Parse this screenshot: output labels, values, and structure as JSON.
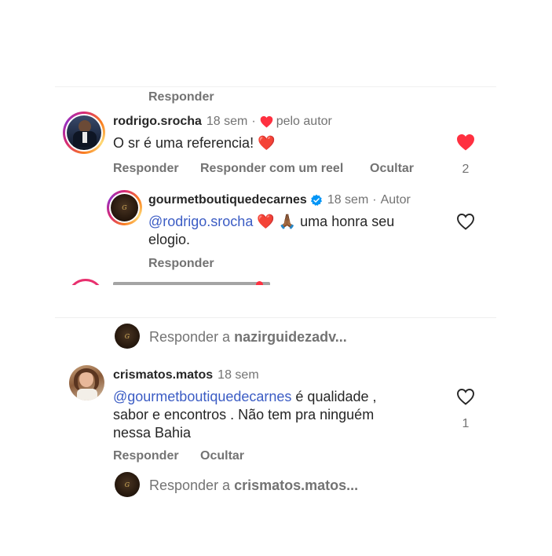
{
  "comments": [
    {
      "username": "rodrigo.srocha",
      "time": "18 sem",
      "author_like_label": "pelo autor",
      "text": "O sr é uma referencia! ❤️",
      "actions": [
        "Responder",
        "Responder com um reel",
        "Ocultar"
      ],
      "likes": "2",
      "liked": true,
      "reply": {
        "username": "gourmetboutiquedecarnes",
        "time": "18 sem",
        "author_badge": "Autor",
        "mention": "@rodrigo.srocha",
        "text_line1_after_mention": " ❤️ 🙏🏾 uma honra seu",
        "text_line2": "elogio.",
        "action": "Responder"
      }
    },
    {
      "username": "crismatos.matos",
      "time": "18 sem",
      "mention": "@gourmetboutiquedecarnes",
      "text_line1_after_mention": " é qualidade ,",
      "text_line2": "sabor e encontros . Não tem pra ninguém",
      "text_line3": "nessa Bahia",
      "actions": [
        "Responder",
        "Ocultar"
      ],
      "likes": "1"
    }
  ],
  "top_reply_label": "Responder",
  "reply_prompts": [
    {
      "prefix": "Responder a ",
      "user": "nazirguidezadv..."
    },
    {
      "prefix": "Responder a ",
      "user": "crismatos.matos..."
    }
  ],
  "colors": {
    "like_red": "#ff3040",
    "verified_blue": "#0095f6",
    "mention_blue": "#3b5cc4",
    "secondary_text": "#737373"
  },
  "icons": [
    "heart-filled-icon",
    "heart-outline-icon",
    "verified-badge-icon"
  ]
}
